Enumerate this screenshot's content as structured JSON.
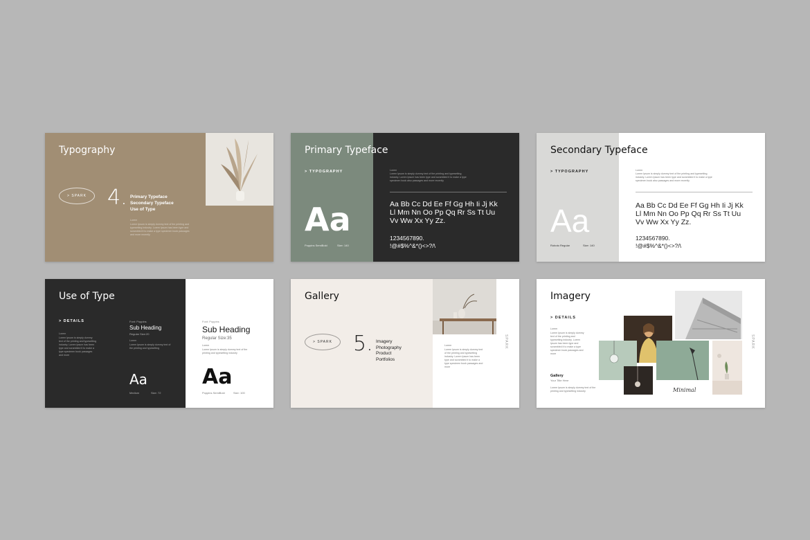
{
  "slides": {
    "typography": {
      "title": "Typography",
      "pill": "> SPARK",
      "number": "4.",
      "items": [
        "Primary Typeface",
        "Secondary Typeface",
        "Use of Type"
      ],
      "small_label": "Lorem",
      "body": "Lorem Ipsum is simply dummy text of the printing and typesetting industry. Lorem Ipsum has been type and scrambled it to make a type specimen book passages and more recently"
    },
    "primary": {
      "title": "Primary Typeface",
      "kicker": "> TYPOGRAPHY",
      "sample": "Aa",
      "font_name": "Poppins SemiBold",
      "size_label": "Size: 140",
      "small_label": "Lorem",
      "body": "Lorem Ipsum is simply dummy text of the printing and typesetting industry. Lorem Ipsum has been type and scrambled it to make a type specimen book also passages and more recently",
      "alphabet_1": "Aa Bb Cc Dd Ee Ff Gg Hh Ii Jj Kk",
      "alphabet_2": "Ll Mm Nn Oo Pp Qq Rr Ss Tt Uu",
      "alphabet_3": "Vv Ww Xx Yy Zz.",
      "numbers": "1234567890.",
      "symbols": "!@#$%^&*()<>?/\\"
    },
    "secondary": {
      "title": "Secondary Typeface",
      "kicker": "> TYPOGRAPHY",
      "sample": "Aa",
      "font_name": "Roboto Regular",
      "size_label": "Size: 140",
      "small_label": "Lorem",
      "body": "Lorem Ipsum is simply dummy text of the printing and typesetting industry. Lorem Ipsum has been type and scrambled it to make a type specimen book also passages and more recently",
      "alphabet_1": "Aa Bb Cc Dd Ee Ff Gg Hh Ii Jj Kk",
      "alphabet_2": "Ll Mm Nn Oo Pp Qq Rr Ss Tt Uu",
      "alphabet_3": "Vv Ww Xx Yy Zz.",
      "numbers": "1234567890.",
      "symbols": "!@#$%^&*()<>?/\\"
    },
    "use_of_type": {
      "title": "Use of Type",
      "kicker": "> DETAILS",
      "small_label": "Lorem",
      "body": "Lorem Ipsum is simply dummy text of the printing and typesetting industry. Lorem Ipsum has been type and scrambled it to make a type specimen book passages and more",
      "mid_font": "Font: Poppins",
      "mid_heading": "Sub Heading",
      "mid_meta": "Regular Size:20",
      "mid_label": "Lorem",
      "mid_body": "Lorem Ipsum is simply dummy text of the printing and typesetting",
      "mid_sample": "Aa",
      "mid_weight": "Medium",
      "mid_size": "Size: 72",
      "right_font": "Font: Poppins",
      "right_heading": "Sub Heading",
      "right_meta": "Regular Size:35",
      "right_label": "Lorem",
      "right_body": "Lorem Ipsum is simply dummy text of the printing and typesetting industry",
      "right_sample": "Aa",
      "right_weight": "Poppins SemiBold",
      "right_size": "Size: 100"
    },
    "gallery": {
      "title": "Gallery",
      "pill": "> SPARK",
      "number": "5.",
      "items": [
        "Imagery",
        "Photography",
        "Product",
        "Portfolios"
      ],
      "small_label": "Lorem",
      "body": "Lorem Ipsum is simply dummy text of the printing and typesetting industry. Lorem Ipsum has been type and scrambled it to make a type specimen book passages and more",
      "vertical": "SPARK"
    },
    "imagery": {
      "title": "Imagery",
      "kicker": "> DETAILS",
      "small_label": "Lorem",
      "body": "Lorem Ipsum is simply dummy text of the printing and typesetting industry. Lorem Ipsum has been type and scrambled it to make a type specimen book passages and more",
      "gallery_label": "Gallery",
      "gallery_sub": "Your Title Here",
      "gallery_body": "Lorem Ipsum is simply dummy text of the printing and typesetting industry",
      "script": "Minimal",
      "vertical": "SPARK"
    }
  },
  "colors": {
    "page": "#b7b7b7",
    "tan": "#a18e74",
    "sage": "#7c8a7d",
    "charcoal": "#2a2a2a",
    "cream": "#f2ede8",
    "light_grey": "#d9d9d7"
  }
}
